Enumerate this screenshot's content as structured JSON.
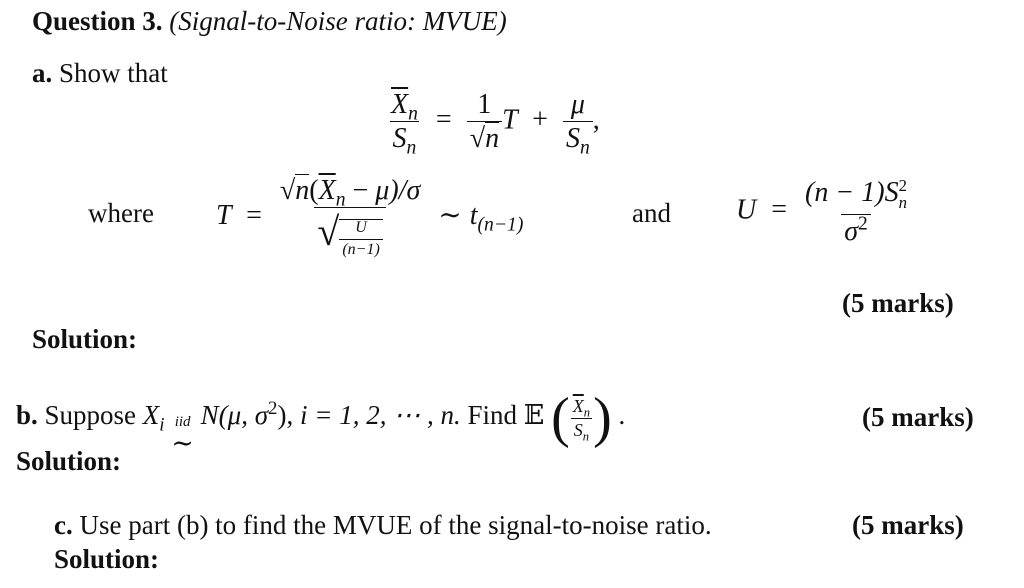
{
  "question": {
    "number_label": "Question 3.",
    "topic": "(Signal-to-Noise ratio: MVUE)"
  },
  "part_a": {
    "label": "a.",
    "text": "Show that",
    "eq1": {
      "lhs_num": "X",
      "lhs_num_sub": "n",
      "lhs_den": "S",
      "lhs_den_sub": "n",
      "equals": "=",
      "coef_num": "1",
      "coef_den_rad": "√",
      "coef_den_var": "n",
      "T": "T",
      "plus": "+",
      "mu": "μ",
      "den2": "S",
      "den2_sub": "n",
      "comma": ","
    },
    "where_label": "where",
    "T_def": {
      "lhs": "T",
      "equals": "=",
      "num_rad": "√",
      "num_var": "n",
      "num_open": "(",
      "num_X": "X",
      "num_X_sub": "n",
      "num_minus": "−",
      "num_mu": "μ",
      "num_close": ")/σ",
      "den_rad": "√",
      "den_U": "U",
      "den_nm1": "(n−1)",
      "dist": "∼",
      "t": "t",
      "t_sub": "(n−1)"
    },
    "and_label": "and",
    "U_def": {
      "lhs": "U",
      "equals": "=",
      "num": "(n − 1)S",
      "num_sup": "2",
      "num_sub": "n",
      "den": "σ",
      "den_sup": "2"
    },
    "marks": "(5 marks)"
  },
  "solution_a": "Solution:",
  "part_b": {
    "label": "b.",
    "text_suppose": "Suppose",
    "X": "X",
    "X_sub": "i",
    "iid": "iid",
    "sim": "∼",
    "dist": "N(μ, σ",
    "dist_sup": "2",
    "dist_close": "),",
    "index": "i = 1, 2,  ⋯ , n.",
    "find": "Find",
    "E": "𝔼",
    "frac_num": "X",
    "frac_num_sub": "n",
    "frac_den": "S",
    "frac_den_sub": "n",
    "period": ".",
    "marks": "(5 marks)"
  },
  "solution_b": "Solution:",
  "part_c": {
    "label": "c.",
    "text": "Use part (b) to find the MVUE of the signal-to-noise ratio.",
    "marks": "(5 marks)"
  },
  "solution_c": "Solution:"
}
